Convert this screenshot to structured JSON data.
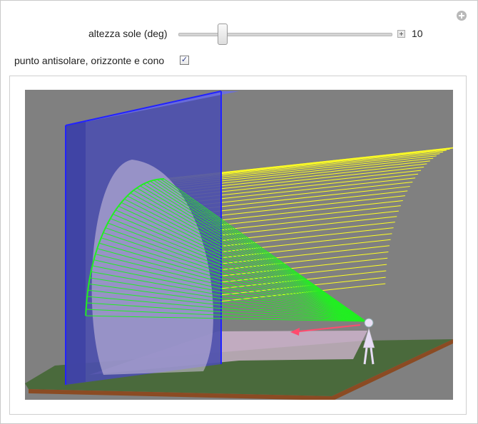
{
  "controls": {
    "slider_label": "altezza sole (deg)",
    "slider_value": "10",
    "slider_level": 10,
    "checkbox_label": "punto antisolare, orizzonte e cono",
    "checkbox_checked": true
  },
  "colors": {
    "background_gray": "#808080",
    "wall_blue": "#4b4fae",
    "wall_edge": "#2222ff",
    "cone_green": "#22ee22",
    "rays_yellow": "#ffff22",
    "ground_green": "#4a6a3c",
    "ground_edge": "#8b4b23",
    "shadow_pink": "#d7b9d6",
    "arrow_red": "#ff4b6e"
  },
  "icons": {
    "panel_plus": "plus-circle-icon",
    "slider_expand": "plus-box-icon",
    "check": "check-icon"
  }
}
